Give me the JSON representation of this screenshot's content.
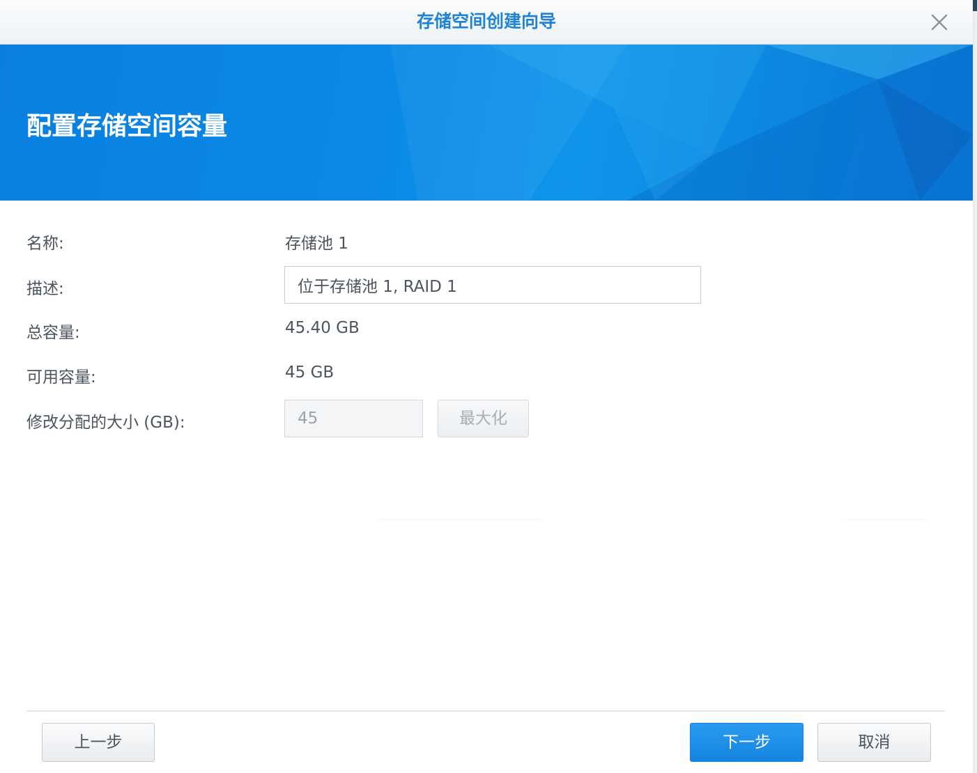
{
  "window": {
    "title": "存储空间创建向导",
    "close_icon": "close-icon"
  },
  "banner": {
    "heading": "配置存储空间容量"
  },
  "form": {
    "name": {
      "label": "名称:",
      "value": "存储池 1"
    },
    "description": {
      "label": "描述:",
      "value": "位于存储池 1, RAID 1"
    },
    "total_capacity": {
      "label": "总容量:",
      "value": "45.40 GB"
    },
    "available_capacity": {
      "label": "可用容量:",
      "value": "45 GB"
    },
    "allocated_size": {
      "label": "修改分配的大小 (GB):",
      "value": "45",
      "maximize_label": "最大化"
    }
  },
  "footer": {
    "back_label": "上一步",
    "next_label": "下一步",
    "cancel_label": "取消"
  },
  "colors": {
    "title_blue": "#1f84d6",
    "banner_blue": "#0a86e4",
    "primary_button": "#1f8fe8",
    "label_text": "#4a5560"
  }
}
